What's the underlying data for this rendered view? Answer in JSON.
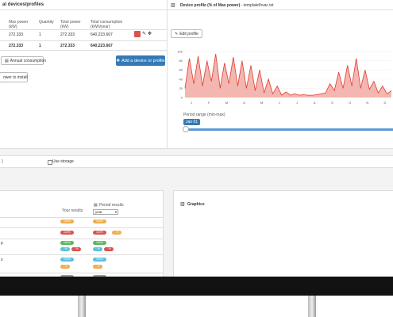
{
  "devices_panel": {
    "title": "al devices/profiles",
    "columns": [
      "Max power (kW)",
      "Quantity",
      "Total power (kW)",
      "Total consumption (kWh/year)"
    ],
    "rows": [
      {
        "max_power": "272.333",
        "quantity": "1",
        "total_power": "272.333",
        "total_consumption": "640,223.667"
      }
    ],
    "totals": {
      "max_power": "272.333",
      "quantity": "1",
      "total_power": "272.333",
      "total_consumption": "640,223.667"
    },
    "annual_button": "Annual consumption",
    "add_button": "Add a device or profile",
    "install_button": "ower to install"
  },
  "profile_panel": {
    "title": "Device profile (% of Max power)",
    "subtitle": "- template/hvac.txt",
    "edit_button": "Edit profile",
    "period_label": "Period range (min-max)",
    "period_value": "Jan 01"
  },
  "chart_data": {
    "type": "line",
    "y_ticks": [
      "100",
      "80",
      "60",
      "40",
      "20",
      "0"
    ],
    "x_ticks": [
      "J",
      "F",
      "M",
      "A",
      "M",
      "J",
      "J",
      "A",
      "S",
      "O",
      "N",
      "D"
    ],
    "ylim": [
      0,
      100
    ],
    "series": [
      {
        "values": [
          20,
          85,
          30,
          90,
          25,
          80,
          35,
          95,
          20,
          75,
          30,
          88,
          25,
          80,
          20,
          70,
          15,
          60,
          10,
          40,
          8,
          25,
          5,
          12,
          5,
          8,
          5,
          6,
          5,
          5,
          6,
          8,
          10,
          30,
          15,
          55,
          20,
          70,
          25,
          85,
          20,
          60,
          18,
          35,
          10,
          25,
          8,
          15
        ]
      }
    ],
    "colors": {
      "line": "#e03b2f",
      "fill": "#f4b6b0"
    }
  },
  "storage_bar": {
    "left_text": ")",
    "checkbox_label": "Use storage"
  },
  "results_panel": {
    "your_results_header": "Your results",
    "period_results_header": "Period results",
    "period_select_value": "year",
    "badges": [
      "100%",
      "100%",
      "100%",
      "100%",
      "- %",
      "- %",
      "- %",
      "- %",
      "100%",
      "100%"
    ],
    "row_labels": [
      "p",
      "s"
    ]
  },
  "graphics_panel": {
    "title": "Graphics"
  },
  "icons": {
    "chart": "bar-chart-icon",
    "edit": "pencil-icon",
    "plus": "plus-icon",
    "calendar": "calendar-icon"
  }
}
